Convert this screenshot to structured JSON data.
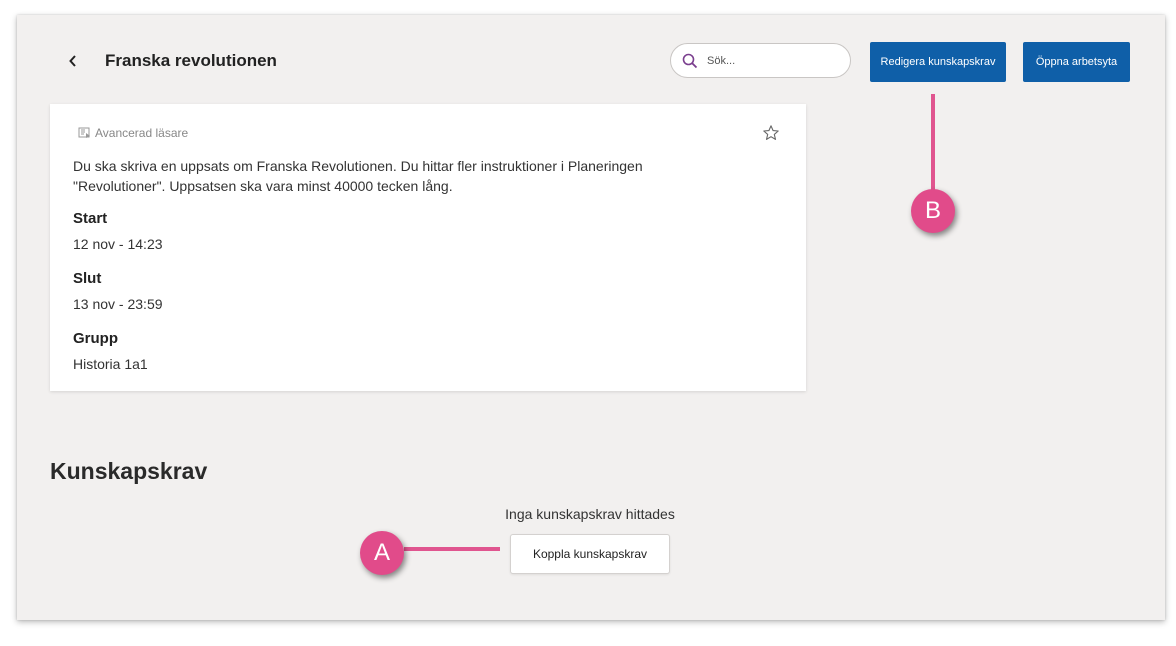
{
  "header": {
    "back_icon": "chevron-left-icon",
    "title": "Franska revolutionen",
    "search_placeholder": "Sök...",
    "search_icon": "search-icon",
    "edit_button": "Redigera kunskapskrav",
    "open_button": "Öppna arbetsyta"
  },
  "card": {
    "reader_icon": "immersive-reader-icon",
    "reader_label": "Avancerad läsare",
    "favorite_icon": "star-icon",
    "description": "Du ska skriva en uppsats om Franska Revolutionen. Du hittar fler instruktioner i Planeringen \"Revolutioner\". Uppsatsen ska vara minst 40000 tecken lång.",
    "fields": [
      {
        "label": "Start",
        "value": "12 nov - 14:23"
      },
      {
        "label": "Slut",
        "value": "13 nov - 23:59"
      },
      {
        "label": "Grupp",
        "value": "Historia 1a1"
      }
    ]
  },
  "criteria": {
    "title": "Kunskapskrav",
    "empty_message": "Inga kunskapskrav hittades",
    "connect_button": "Koppla kunskapskrav"
  },
  "annotations": {
    "marker_a": "A",
    "marker_b": "B",
    "color": "#e14b8a"
  },
  "colors": {
    "primary": "#0f5fa8",
    "background": "#f2f0ef"
  }
}
